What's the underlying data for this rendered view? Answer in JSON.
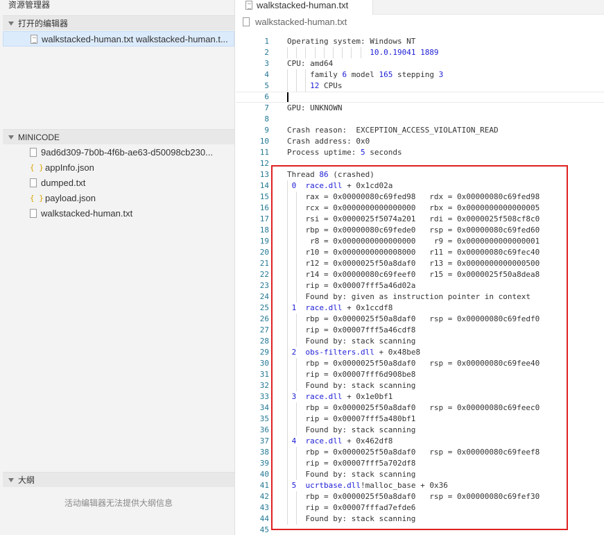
{
  "sidebar": {
    "title": "资源管理器",
    "open_editors": {
      "header": "打开的编辑器",
      "items": [
        {
          "label": "walkstacked-human.txt  walkstacked-human.t..."
        }
      ]
    },
    "project": {
      "header": "MINICODE",
      "files": [
        {
          "label": "9ad6d309-7b0b-4f6b-ae63-d50098cb230...",
          "type": "file"
        },
        {
          "label": "appInfo.json",
          "type": "json"
        },
        {
          "label": "dumped.txt",
          "type": "file"
        },
        {
          "label": "payload.json",
          "type": "json"
        },
        {
          "label": "walkstacked-human.txt",
          "type": "file"
        }
      ]
    },
    "outline": {
      "header": "大纲",
      "message": "活动编辑器无法提供大纲信息"
    }
  },
  "editor": {
    "tab_label": "walkstacked-human.txt",
    "breadcrumb": "walkstacked-human.txt",
    "lines": [
      "Operating system: Windows NT",
      "                  10.0.19041 1889",
      "CPU: amd64",
      "     family 6 model 165 stepping 3",
      "     12 CPUs",
      "",
      "GPU: UNKNOWN",
      "",
      "Crash reason:  EXCEPTION_ACCESS_VIOLATION_READ",
      "Crash address: 0x0",
      "Process uptime: 5 seconds",
      "",
      "Thread 86 (crashed)",
      " 0  race.dll + 0x1cd02a",
      "    rax = 0x00000080c69fed98   rdx = 0x00000080c69fed98",
      "    rcx = 0x0000000000000000   rbx = 0x0000000000000005",
      "    rsi = 0x0000025f5074a201   rdi = 0x0000025f508cf8c0",
      "    rbp = 0x00000080c69fede0   rsp = 0x00000080c69fed60",
      "     r8 = 0x0000000000000000    r9 = 0x0000000000000001",
      "    r10 = 0x0000000000008000   r11 = 0x00000080c69fec40",
      "    r12 = 0x0000025f50a8daf0   r13 = 0x0000000000000500",
      "    r14 = 0x00000080c69feef0   r15 = 0x0000025f50a8dea8",
      "    rip = 0x00007fff5a46d02a",
      "    Found by: given as instruction pointer in context",
      " 1  race.dll + 0x1ccdf8",
      "    rbp = 0x0000025f50a8daf0   rsp = 0x00000080c69fedf0",
      "    rip = 0x00007fff5a46cdf8",
      "    Found by: stack scanning",
      " 2  obs-filters.dll + 0x48be8",
      "    rbp = 0x0000025f50a8daf0   rsp = 0x00000080c69fee40",
      "    rip = 0x00007fff6d908be8",
      "    Found by: stack scanning",
      " 3  race.dll + 0x1e0bf1",
      "    rbp = 0x0000025f50a8daf0   rsp = 0x00000080c69feec0",
      "    rip = 0x00007fff5a480bf1",
      "    Found by: stack scanning",
      " 4  race.dll + 0x462df8",
      "    rbp = 0x0000025f50a8daf0   rsp = 0x00000080c69feef8",
      "    rip = 0x00007fff5a702df8",
      "    Found by: stack scanning",
      " 5  ucrtbase.dll!malloc_base + 0x36",
      "    rbp = 0x0000025f50a8daf0   rsp = 0x00000080c69fef30",
      "    rip = 0x00007fffad7efde6",
      "    Found by: stack scanning",
      ""
    ]
  },
  "colors": {
    "accent_selection": "#dcebfb",
    "line_number": "#237893",
    "highlight_box": "#e02020",
    "number": "#1c1cd6"
  }
}
